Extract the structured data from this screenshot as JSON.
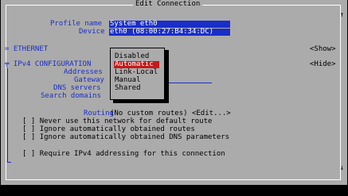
{
  "dialog": {
    "title": "Edit Connection"
  },
  "profile": {
    "name_label": "Profile name",
    "name_value": "System eth0",
    "device_label": "Device",
    "device_value": "eth0 (08:00:27:B4:34:DC)"
  },
  "ethernet": {
    "label": "= ETHERNET",
    "toggle": "<Show>"
  },
  "ipv4": {
    "label": "╤ IPv4 CONFIGURATION",
    "toggle": "<Hide>",
    "addresses_label": "Addresses",
    "gateway_label": "Gateway",
    "dns_label": "DNS servers",
    "search_label": "Search domains",
    "routing_label": "Routing",
    "routing_value": "(No custom routes) <Edit...>"
  },
  "checkboxes": [
    {
      "box": "[ ]",
      "label": "Never use this network for default route"
    },
    {
      "box": "[ ]",
      "label": "Ignore automatically obtained routes"
    },
    {
      "box": "[ ]",
      "label": "Ignore automatically obtained DNS parameters"
    },
    {
      "box": "[ ]",
      "label": "Require IPv4 addressing for this connection"
    }
  ],
  "method_menu": {
    "options": [
      "Disabled",
      "Automatic",
      "Link-Local",
      "Manual",
      "Shared"
    ],
    "selected": "Automatic"
  },
  "scrollbar": {
    "up": "↑",
    "down": "↓"
  },
  "colors": {
    "background": "#ababab",
    "field": "#1a2ec8",
    "selection": "#c41a1a"
  }
}
